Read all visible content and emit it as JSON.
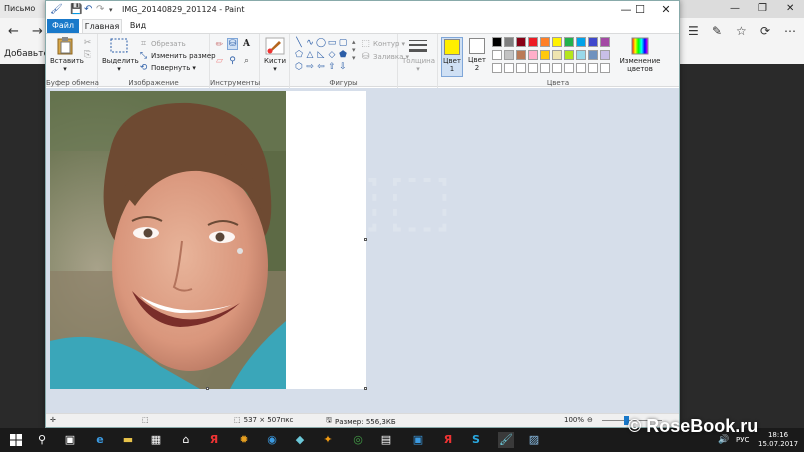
{
  "edge": {
    "tab_title": "Письмо",
    "favorites_text": "Добавьте"
  },
  "paint": {
    "window_title": "IMG_20140829_201124 - Paint",
    "tabs": {
      "file": "Файл",
      "home": "Главная",
      "view": "Вид"
    },
    "clipboard": {
      "paste": "Вставить",
      "label": "Буфер обмена"
    },
    "image": {
      "select": "Выделить",
      "crop": "Обрезать",
      "resize": "Изменить размер",
      "rotate": "Повернуть",
      "label": "Изображение"
    },
    "tools": {
      "label": "Инструменты",
      "text_glyph": "A"
    },
    "brushes": {
      "label": "Кисти"
    },
    "shapes": {
      "outline": "Контур",
      "fill": "Заливка",
      "label": "Фигуры"
    },
    "size": {
      "label": "Толщина"
    },
    "colors": {
      "color1": "Цвет\n1",
      "color1_value": "#ffef00",
      "color2": "Цвет\n2",
      "color2_value": "#ffffff",
      "edit_colors": "Изменение цветов",
      "label": "Цвета",
      "palette_row1": [
        "#000000",
        "#7f7f7f",
        "#880015",
        "#ed1c24",
        "#ff7f27",
        "#fff200",
        "#22b14c",
        "#00a2e8",
        "#3f48cc",
        "#a349a4"
      ],
      "palette_row2": [
        "#ffffff",
        "#c3c3c3",
        "#b97a57",
        "#ffaec9",
        "#ffc90e",
        "#efe4b0",
        "#b5e61d",
        "#99d9ea",
        "#7092be",
        "#c8bfe7"
      ]
    },
    "status": {
      "dimensions": "537 × 507пкс",
      "size": "Размер: 556,3КБ",
      "zoom": "100%"
    }
  },
  "taskbar": {
    "lang": "РУС",
    "time": "18:16",
    "date": "15.07.2017"
  },
  "watermark": "© RoseBook.ru"
}
